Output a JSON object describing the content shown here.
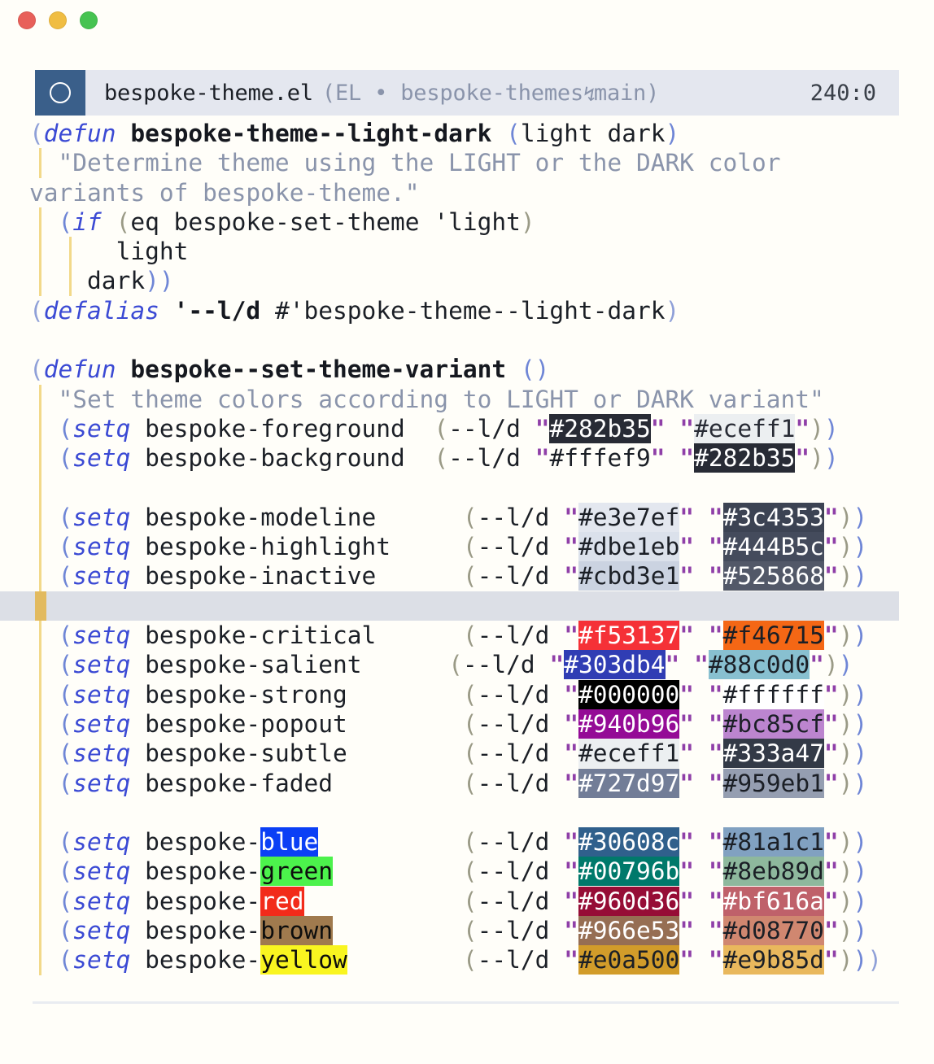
{
  "window": {
    "background": "#fffef9",
    "traffic_lights": [
      {
        "name": "close",
        "color": "#e8605a"
      },
      {
        "name": "minimize",
        "color": "#f0bd42"
      },
      {
        "name": "zoom",
        "color": "#46c351"
      }
    ]
  },
  "modeline": {
    "status_icon": "circle-outline-icon",
    "status_bg": "#3a5f8a",
    "filename": "bespoke-theme.el",
    "meta_prefix": "(EL ",
    "bullet": "•",
    "project": " bespoke-themes",
    "branch_icon": "git-branch-icon",
    "branch": "main",
    "meta_suffix": ")",
    "position": "240:0",
    "bg": "#e4e7ef"
  },
  "code": {
    "lines": [
      {
        "id": "l1",
        "guides": [],
        "tokens": [
          {
            "t": "(",
            "c": "p1"
          },
          {
            "t": "defun",
            "c": "kw"
          },
          {
            "t": " ",
            "c": "plain"
          },
          {
            "t": "bespoke-theme--light-dark",
            "c": "fname"
          },
          {
            "t": " ",
            "c": "plain"
          },
          {
            "t": "(",
            "c": "p3"
          },
          {
            "t": "light dark",
            "c": "plain"
          },
          {
            "t": ")",
            "c": "p3"
          }
        ]
      },
      {
        "id": "l2",
        "guides": [
          "g1"
        ],
        "tokens": [
          {
            "t": "  \"Determine theme using the LIGHT or the DARK color",
            "c": "doc"
          }
        ]
      },
      {
        "id": "l3",
        "guides": [],
        "indent0": true,
        "tokens": [
          {
            "t": "variants of bespoke-theme.\"",
            "c": "doc"
          }
        ]
      },
      {
        "id": "l4",
        "guides": [
          "g1"
        ],
        "tokens": [
          {
            "t": "  (",
            "c": "p3"
          },
          {
            "t": "if",
            "c": "kw"
          },
          {
            "t": " ",
            "c": "plain"
          },
          {
            "t": "(",
            "c": "p2"
          },
          {
            "t": "eq bespoke-set-theme 'light",
            "c": "plain"
          },
          {
            "t": ")",
            "c": "p2"
          }
        ]
      },
      {
        "id": "l5",
        "guides": [
          "g1",
          "g2"
        ],
        "tokens": [
          {
            "t": "      light",
            "c": "plain"
          }
        ]
      },
      {
        "id": "l6",
        "guides": [
          "g1",
          "g2"
        ],
        "tokens": [
          {
            "t": "    dark",
            "c": "plain"
          },
          {
            "t": "))",
            "c": "p3"
          }
        ]
      },
      {
        "id": "l7",
        "guides": [],
        "tokens": [
          {
            "t": "(",
            "c": "p1"
          },
          {
            "t": "defalias",
            "c": "kw"
          },
          {
            "t": " ",
            "c": "plain"
          },
          {
            "t": "'--l/d",
            "c": "sym"
          },
          {
            "t": " #'bespoke-theme--light-dark",
            "c": "plain"
          },
          {
            "t": ")",
            "c": "p1"
          }
        ]
      },
      {
        "id": "l8",
        "guides": [],
        "tokens": []
      },
      {
        "id": "l9",
        "guides": [],
        "tokens": [
          {
            "t": "(",
            "c": "p1"
          },
          {
            "t": "defun",
            "c": "kw"
          },
          {
            "t": " ",
            "c": "plain"
          },
          {
            "t": "bespoke--set-theme-variant",
            "c": "fname"
          },
          {
            "t": " ",
            "c": "plain"
          },
          {
            "t": "()",
            "c": "p3"
          }
        ]
      },
      {
        "id": "l10",
        "guides": [
          "g1"
        ],
        "tokens": [
          {
            "t": "  \"Set theme colors according to LIGHT or DARK variant\"",
            "c": "doc"
          }
        ]
      },
      {
        "id": "l11",
        "guides": [
          "g1"
        ],
        "setq": {
          "var": "bespoke-foreground",
          "pad": 2,
          "light": {
            "hex": "#282b35",
            "bg": "#282b35",
            "fg": "#ffffff"
          },
          "dark": {
            "hex": "#eceff1",
            "bg": "#eceff1",
            "fg": "#282b35"
          },
          "tail": "))"
        }
      },
      {
        "id": "l12",
        "guides": [
          "g1"
        ],
        "setq": {
          "var": "bespoke-background",
          "pad": 2,
          "light": {
            "hex": "#fffef9",
            "bg": "transparent",
            "fg": "#1b1f26"
          },
          "dark": {
            "hex": "#282b35",
            "bg": "#282b35",
            "fg": "#ffffff"
          },
          "tail": "))"
        }
      },
      {
        "id": "l13",
        "guides": [
          "g1"
        ],
        "tokens": []
      },
      {
        "id": "l14",
        "guides": [
          "g1"
        ],
        "setq": {
          "var": "bespoke-modeline",
          "pad": 6,
          "light": {
            "hex": "#e3e7ef",
            "bg": "#e3e7ef",
            "fg": "#1b1f26"
          },
          "dark": {
            "hex": "#3c4353",
            "bg": "#3c4353",
            "fg": "#ffffff"
          },
          "tail": "))"
        }
      },
      {
        "id": "l15",
        "guides": [
          "g1"
        ],
        "setq": {
          "var": "bespoke-highlight",
          "pad": 5,
          "light": {
            "hex": "#dbe1eb",
            "bg": "#dbe1eb",
            "fg": "#1b1f26"
          },
          "dark": {
            "hex": "#444B5c",
            "bg": "#444B5c",
            "fg": "#ffffff"
          },
          "tail": "))"
        }
      },
      {
        "id": "l16",
        "guides": [
          "g1"
        ],
        "setq": {
          "var": "bespoke-inactive",
          "pad": 6,
          "light": {
            "hex": "#cbd3e1",
            "bg": "#cbd3e1",
            "fg": "#1b1f26"
          },
          "dark": {
            "hex": "#525868",
            "bg": "#525868",
            "fg": "#ffffff"
          },
          "tail": "))"
        }
      },
      {
        "id": "l17",
        "guides": [
          "gold"
        ],
        "current": true,
        "tokens": []
      },
      {
        "id": "l18",
        "guides": [
          "g1"
        ],
        "setq": {
          "var": "bespoke-critical",
          "pad": 6,
          "light": {
            "hex": "#f53137",
            "bg": "#f53137",
            "fg": "#ffffff"
          },
          "dark": {
            "hex": "#f46715",
            "bg": "#f46715",
            "fg": "#1b1f26"
          },
          "tail": "))"
        }
      },
      {
        "id": "l19",
        "guides": [
          "g1"
        ],
        "setq": {
          "var": "bespoke-salient",
          "pad": 6,
          "light": {
            "hex": "#303db4",
            "bg": "#303db4",
            "fg": "#ffffff"
          },
          "dark": {
            "hex": "#88c0d0",
            "bg": "#88c0d0",
            "fg": "#1b1f26"
          },
          "tail": "))"
        }
      },
      {
        "id": "l20",
        "guides": [
          "g1"
        ],
        "setq": {
          "var": "bespoke-strong",
          "pad": 8,
          "light": {
            "hex": "#000000",
            "bg": "#000000",
            "fg": "#ffffff"
          },
          "dark": {
            "hex": "#ffffff",
            "bg": "#ffffff",
            "fg": "#1b1f26"
          },
          "tail": "))"
        }
      },
      {
        "id": "l21",
        "guides": [
          "g1"
        ],
        "setq": {
          "var": "bespoke-popout",
          "pad": 8,
          "light": {
            "hex": "#940b96",
            "bg": "#940b96",
            "fg": "#ffffff"
          },
          "dark": {
            "hex": "#bc85cf",
            "bg": "#bc85cf",
            "fg": "#1b1f26"
          },
          "tail": "))"
        }
      },
      {
        "id": "l22",
        "guides": [
          "g1"
        ],
        "setq": {
          "var": "bespoke-subtle",
          "pad": 8,
          "light": {
            "hex": "#eceff1",
            "bg": "#eceff1",
            "fg": "#1b1f26"
          },
          "dark": {
            "hex": "#333a47",
            "bg": "#333a47",
            "fg": "#ffffff"
          },
          "tail": "))"
        }
      },
      {
        "id": "l23",
        "guides": [
          "g1"
        ],
        "setq": {
          "var": "bespoke-faded",
          "pad": 9,
          "light": {
            "hex": "#727d97",
            "bg": "#727d97",
            "fg": "#ffffff"
          },
          "dark": {
            "hex": "#959eb1",
            "bg": "#959eb1",
            "fg": "#1b1f26"
          },
          "tail": "))"
        }
      },
      {
        "id": "l24",
        "guides": [
          "g1"
        ],
        "tokens": []
      },
      {
        "id": "l25",
        "guides": [
          "g1"
        ],
        "setq": {
          "var": "bespoke-",
          "word": {
            "text": "blue",
            "bg": "#0b3ff5",
            "fg": "#ffffff"
          },
          "pad": 10,
          "light": {
            "hex": "#30608c",
            "bg": "#30608c",
            "fg": "#ffffff"
          },
          "dark": {
            "hex": "#81a1c1",
            "bg": "#81a1c1",
            "fg": "#1b1f26"
          },
          "tail": "))"
        }
      },
      {
        "id": "l26",
        "guides": [
          "g1"
        ],
        "setq": {
          "var": "bespoke-",
          "word": {
            "text": "green",
            "bg": "#4cf24c",
            "fg": "#0d0d0d"
          },
          "pad": 9,
          "light": {
            "hex": "#00796b",
            "bg": "#00796b",
            "fg": "#ffffff"
          },
          "dark": {
            "hex": "#8eb89d",
            "bg": "#8eb89d",
            "fg": "#1b1f26"
          },
          "tail": "))"
        }
      },
      {
        "id": "l27",
        "guides": [
          "g1"
        ],
        "setq": {
          "var": "bespoke-",
          "word": {
            "text": "red",
            "bg": "#f22b1a",
            "fg": "#ffffff"
          },
          "pad": 11,
          "light": {
            "hex": "#960d36",
            "bg": "#960d36",
            "fg": "#ffffff"
          },
          "dark": {
            "hex": "#bf616a",
            "bg": "#bf616a",
            "fg": "#ffffff"
          },
          "tail": "))"
        }
      },
      {
        "id": "l28",
        "guides": [
          "g1"
        ],
        "setq": {
          "var": "bespoke-",
          "word": {
            "text": "brown",
            "bg": "#a07a4e",
            "fg": "#0d0d0d"
          },
          "pad": 9,
          "light": {
            "hex": "#966e53",
            "bg": "#966e53",
            "fg": "#ffffff"
          },
          "dark": {
            "hex": "#d08770",
            "bg": "#d08770",
            "fg": "#1b1f26"
          },
          "tail": "))"
        }
      },
      {
        "id": "l29",
        "guides": [
          "g1"
        ],
        "setq": {
          "var": "bespoke-",
          "word": {
            "text": "yellow",
            "bg": "#f9f520",
            "fg": "#0d0d0d"
          },
          "pad": 8,
          "light": {
            "hex": "#e0a500",
            "bg": "#d29c2a",
            "fg": "#1b1f26"
          },
          "dark": {
            "hex": "#e9b85d",
            "bg": "#e9b85d",
            "fg": "#1b1f26"
          },
          "tail": ")))"
        }
      }
    ]
  },
  "colors": {
    "keyword": "#3b4ad4",
    "function_name": "#15181f",
    "docstring": "#8a94ab",
    "string_quote": "#8f3fa8",
    "paren_l1": "#8fa0d8",
    "paren_l2": "#9a9a86",
    "paren_l3": "#6f86d6",
    "current_line_bg": "#dcdfe6",
    "indent_guide": "#f2d98a",
    "cursor_bar": "#e2ba5f",
    "buffer_bg": "#fffef9"
  }
}
